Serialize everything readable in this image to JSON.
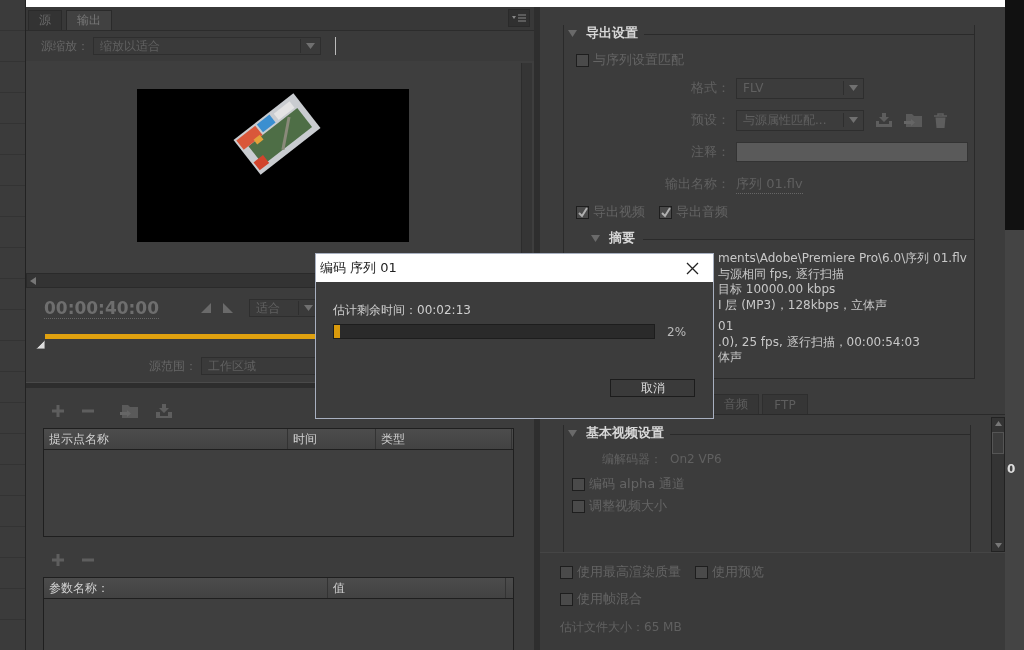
{
  "left_panel": {
    "tabs": [
      {
        "label": "源",
        "selected": false
      },
      {
        "label": "输出",
        "selected": true
      }
    ],
    "source_scale": {
      "label": "源缩放：",
      "value": "缩放以适合"
    },
    "timecode": "00:00:40:00",
    "fit": {
      "value": "适合"
    },
    "source_range": {
      "label": "源范围：",
      "value": "工作区域"
    },
    "cue_table": {
      "columns": [
        "提示点名称",
        "时间",
        "类型"
      ]
    },
    "param_table": {
      "columns": [
        "参数名称：",
        "值"
      ]
    }
  },
  "export_settings": {
    "title": "导出设置",
    "expanded": true,
    "match_sequence": {
      "label": "与序列设置匹配",
      "checked": false
    },
    "fields": [
      {
        "kind": "dropdown",
        "label": "格式：",
        "value": "FLV"
      },
      {
        "kind": "preset",
        "label": "预设：",
        "value": "与源属性匹配..."
      },
      {
        "kind": "input",
        "label": "注释："
      },
      {
        "kind": "link",
        "label": "输出名称：",
        "value": "序列 01.flv"
      }
    ],
    "outputs": [
      {
        "label": "导出视频",
        "checked": true
      },
      {
        "label": "导出音频",
        "checked": true
      }
    ],
    "summary": {
      "title": "摘要",
      "expanded": true,
      "lines": [
        "ments\\Adobe\\Premiere Pro\\6.0\\序列 01.flv",
        "与源相同 fps, 逐行扫描",
        "目标 10000.00 kbps",
        "I 层 (MP3)，128kbps，立体声",
        "01",
        ".0), 25 fps, 逐行扫描，00:00:54:03",
        "体声"
      ]
    }
  },
  "tabs": [
    {
      "label": "音频",
      "selected": false
    },
    {
      "label": "FTP",
      "selected": false
    }
  ],
  "video_settings": {
    "title": "基本视频设置",
    "expanded": true,
    "codec": {
      "label": "编解码器：",
      "value": "On2 VP6"
    },
    "options": [
      {
        "label": "编码 alpha 通道",
        "checked": false
      },
      {
        "label": "调整视频大小",
        "checked": false
      }
    ]
  },
  "bottom": {
    "options": [
      {
        "label": "使用最高渲染质量",
        "checked": false
      },
      {
        "label": "使用预览",
        "checked": false
      },
      {
        "label": "使用帧混合",
        "checked": false
      }
    ],
    "file_size": "估计文件大小：65 MB"
  },
  "right_edge": {
    "text": "0"
  },
  "dialog": {
    "title": "编码 序列 01",
    "remaining": "估计剩余时间：00:02:13",
    "level": 0.02,
    "percent": "2%",
    "cancel": "取消"
  }
}
